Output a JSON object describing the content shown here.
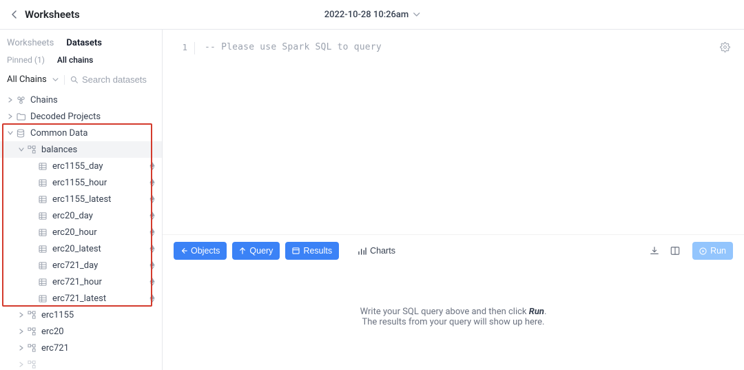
{
  "header": {
    "title": "Worksheets",
    "timestamp": "2022-10-28 10:26am"
  },
  "sidebar": {
    "tabs": {
      "worksheets": "Worksheets",
      "datasets": "Datasets"
    },
    "subtabs": {
      "pinned": "Pinned  (1)",
      "all": "All chains"
    },
    "chain_filter": "All Chains",
    "search_placeholder": "Search datasets",
    "tree": {
      "chains_label": "Chains",
      "decoded_label": "Decoded Projects",
      "common_label": "Common Data",
      "balances_label": "balances",
      "balances_children": [
        "erc1155_day",
        "erc1155_hour",
        "erc1155_latest",
        "erc20_day",
        "erc20_hour",
        "erc20_latest",
        "erc721_day",
        "erc721_hour",
        "erc721_latest"
      ],
      "siblings": [
        "erc1155",
        "erc20",
        "erc721"
      ]
    }
  },
  "editor": {
    "line_no": "1",
    "placeholder_comment": "-- Please use Spark SQL to query"
  },
  "toolbar": {
    "objects": "Objects",
    "query": "Query",
    "results": "Results",
    "charts": "Charts",
    "run": "Run"
  },
  "results_panel": {
    "line1_prefix": "Write your SQL query above and then click ",
    "line1_run": "Run",
    "line1_suffix": ".",
    "line2": "The results from your query will show up here."
  }
}
